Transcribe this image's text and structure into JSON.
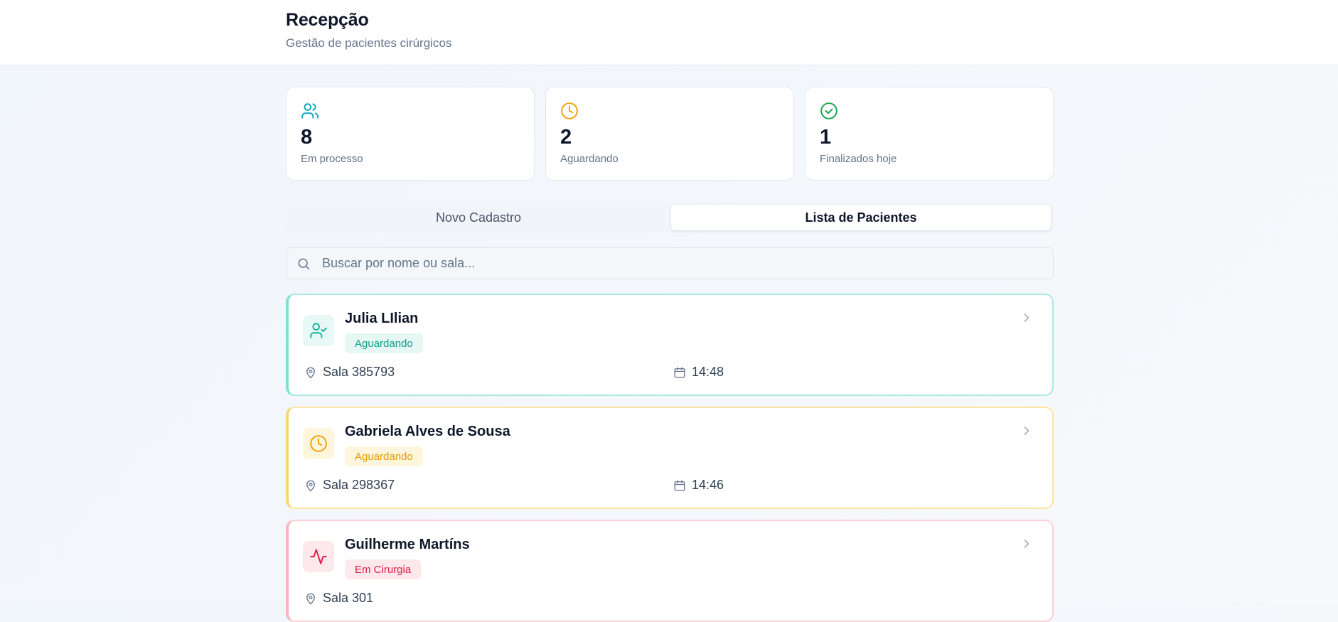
{
  "header": {
    "title": "Recepção",
    "subtitle": "Gestão de pacientes cirúrgicos"
  },
  "stats": [
    {
      "icon": "users-icon",
      "value": "8",
      "label": "Em processo",
      "color": "#0ea5c6"
    },
    {
      "icon": "clock-icon",
      "value": "2",
      "label": "Aguardando",
      "color": "#f59e0b"
    },
    {
      "icon": "check-circle-icon",
      "value": "1",
      "label": "Finalizados hoje",
      "color": "#16a34a"
    }
  ],
  "tabs": [
    {
      "label": "Novo Cadastro",
      "active": false
    },
    {
      "label": "Lista de Pacientes",
      "active": true
    }
  ],
  "search": {
    "placeholder": "Buscar por nome ou sala..."
  },
  "patients": [
    {
      "name": "Julia LIlian",
      "status": "Aguardando",
      "room": "Sala 385793",
      "time": "14:48",
      "icon": "user-check-icon",
      "accent": "#14b8a6"
    },
    {
      "name": "Gabriela Alves de Sousa",
      "status": "Aguardando",
      "room": "Sala 298367",
      "time": "14:46",
      "icon": "clock-icon",
      "accent": "#f59e0b"
    },
    {
      "name": "Guilherme Martíns",
      "status": "Em Cirurgia",
      "room": "Sala 301",
      "time": "",
      "icon": "activity-icon",
      "accent": "#e11d48"
    }
  ]
}
